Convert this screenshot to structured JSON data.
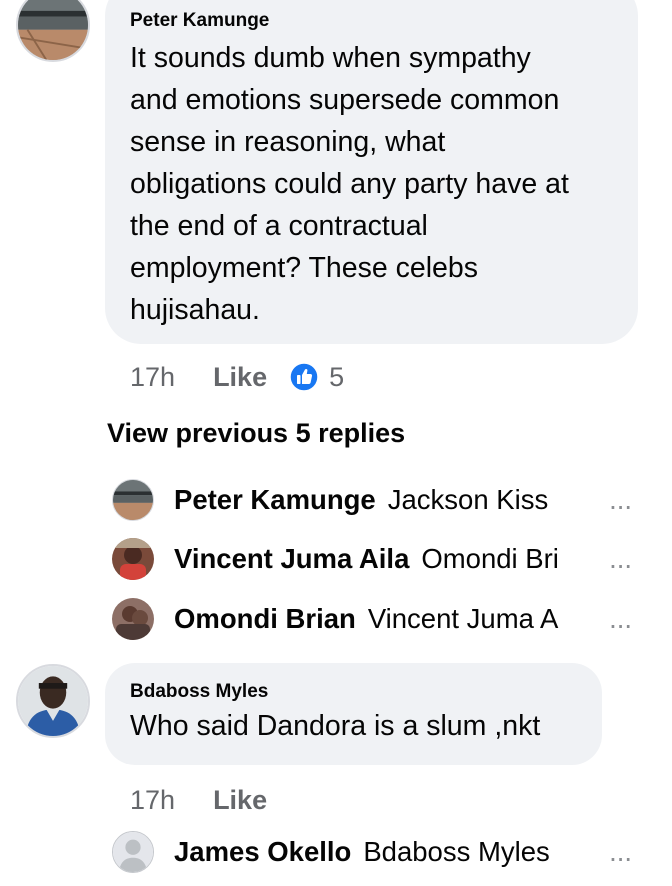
{
  "comments": [
    {
      "author": "Peter Kamunge",
      "text": "It sounds dumb when sympathy\nand emotions supersede common\nsense in reasoning, what\nobligations could any party have at\nthe end of a contractual\nemployment? These celebs\nhujisahau.",
      "time": "17h",
      "like_label": "Like",
      "reaction_icon": "like-thumb-icon",
      "reaction_count": "5"
    },
    {
      "author": "Bdaboss Myles",
      "text": "Who said Dandora is a slum ,nkt",
      "time": "17h",
      "like_label": "Like"
    }
  ],
  "view_previous_label": "View previous 5 replies",
  "replies_first": [
    {
      "author": "Peter Kamunge",
      "preview": "Jackson Kiss",
      "ellipsis": "..."
    },
    {
      "author": "Vincent Juma Aila",
      "preview": "Omondi Bri",
      "ellipsis": "..."
    },
    {
      "author": "Omondi Brian",
      "preview": "Vincent Juma A",
      "ellipsis": "..."
    }
  ],
  "replies_second": [
    {
      "author": "James Okello",
      "preview": "Bdaboss Myles ",
      "ellipsis": "..."
    }
  ],
  "colors": {
    "bubble_bg": "#f0f2f5",
    "meta_text": "#65676b",
    "like_blue": "#1877f2"
  }
}
